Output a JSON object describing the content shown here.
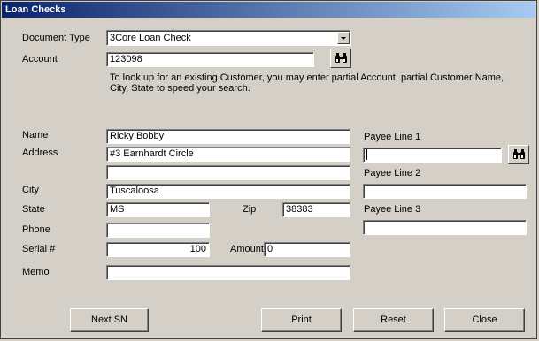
{
  "window": {
    "title": "Loan Checks"
  },
  "document_type": {
    "label": "Document Type",
    "value": "3Core Loan Check"
  },
  "account": {
    "label": "Account",
    "value": "123098"
  },
  "hint": {
    "line1": "To look up for an existing Customer, you may enter partial Account, partial Customer Name,",
    "line2": "City, State to speed your search."
  },
  "customer": {
    "name_label": "Name",
    "name_value": "Ricky Bobby",
    "address_label": "Address",
    "address1_value": "#3 Earnhardt Circle",
    "address2_value": "",
    "city_label": "City",
    "city_value": "Tuscaloosa",
    "state_label": "State",
    "state_value": "MS",
    "zip_label": "Zip",
    "zip_value": "38383",
    "phone_label": "Phone",
    "phone_value": "",
    "serial_label": "Serial #",
    "serial_value": "100",
    "amount_label": "Amount",
    "amount_value": "0",
    "memo_label": "Memo",
    "memo_value": ""
  },
  "payee": {
    "line1_label": "Payee Line 1",
    "line1_value": "",
    "line2_label": "Payee Line 2",
    "line2_value": "",
    "line3_label": "Payee Line 3",
    "line3_value": ""
  },
  "buttons": {
    "next_sn": "Next SN",
    "print": "Print",
    "reset": "Reset",
    "close": "Close"
  },
  "icons": {
    "lookup": "binoculars-icon",
    "dropdown": "chevron-down-icon"
  }
}
